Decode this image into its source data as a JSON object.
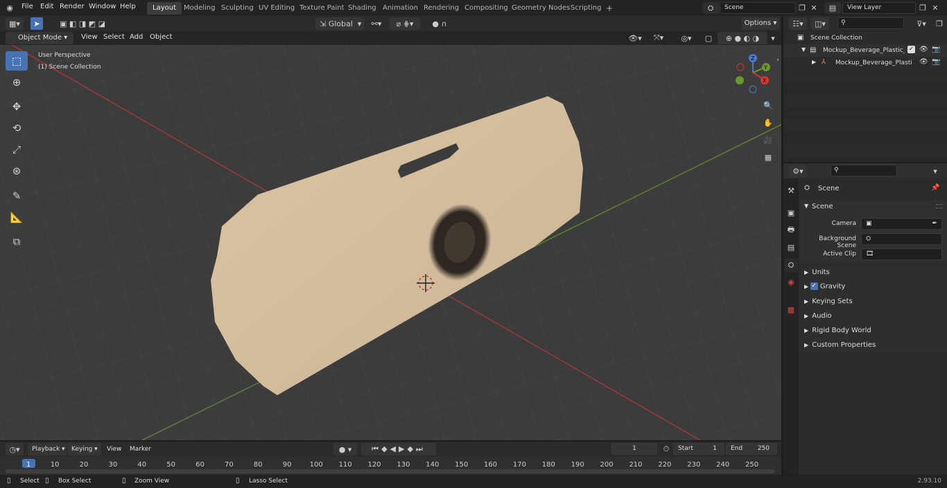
{
  "topbar": {
    "menus": [
      "File",
      "Edit",
      "Render",
      "Window",
      "Help"
    ],
    "workspaces": [
      "Layout",
      "Modeling",
      "Sculpting",
      "UV Editing",
      "Texture Paint",
      "Shading",
      "Animation",
      "Rendering",
      "Compositing",
      "Geometry Nodes",
      "Scripting"
    ],
    "active_workspace": "Layout",
    "add_tab": "+",
    "scene": "Scene",
    "view_layer": "View Layer"
  },
  "viewport_header": {
    "mode": "Object Mode",
    "menus": [
      "View",
      "Select",
      "Add",
      "Object"
    ],
    "orientation": "Global",
    "options": "Options"
  },
  "viewport": {
    "perspective": "User Perspective",
    "collection": "(1) Scene Collection",
    "gizmo": {
      "z": "Z",
      "y": "Y",
      "x": "X"
    }
  },
  "outliner": {
    "root": "Scene Collection",
    "collection": "Mockup_Beverage_Plastic_Cu",
    "object": "Mockup_Beverage_Plasti"
  },
  "properties": {
    "context": "Scene",
    "panel": "Scene",
    "fields": [
      {
        "label": "Camera",
        "value": ""
      },
      {
        "label": "Background Scene",
        "value": ""
      },
      {
        "label": "Active Clip",
        "value": ""
      }
    ],
    "sections": [
      "Units",
      "Gravity",
      "Keying Sets",
      "Audio",
      "Rigid Body World",
      "Custom Properties"
    ],
    "gravity_checked": true
  },
  "timeline": {
    "menus": [
      "Playback",
      "Keying",
      "View",
      "Marker"
    ],
    "current_frame": "1",
    "start_label": "Start",
    "start": "1",
    "end_label": "End",
    "end": "250",
    "ticks": [
      "1",
      "10",
      "20",
      "30",
      "40",
      "50",
      "60",
      "70",
      "80",
      "90",
      "100",
      "110",
      "120",
      "130",
      "140",
      "150",
      "160",
      "170",
      "180",
      "190",
      "200",
      "210",
      "220",
      "230",
      "240",
      "250"
    ]
  },
  "statusbar": {
    "items": [
      "Select",
      "Box Select",
      "Zoom View",
      "Lasso Select"
    ],
    "version": "2.93.10"
  },
  "colors": {
    "accent": "#4772b3",
    "object": "#d7c1a2",
    "x_axis": "#b23a3a",
    "y_axis": "#6b9a2c"
  }
}
